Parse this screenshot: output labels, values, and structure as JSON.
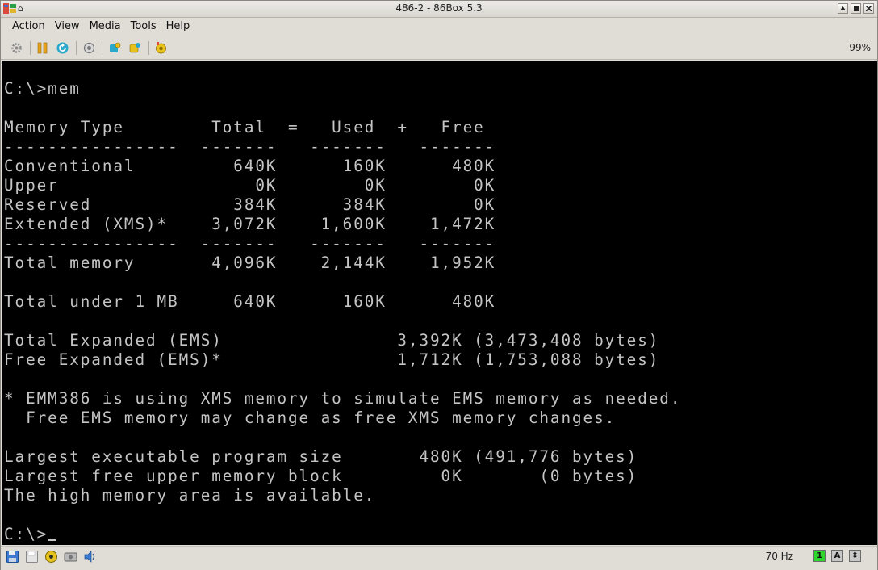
{
  "window": {
    "title": "486-2 - 86Box 5.3"
  },
  "menu": {
    "items": [
      "Action",
      "View",
      "Media",
      "Tools",
      "Help"
    ]
  },
  "toolbar": {
    "icons": [
      "settings-icon",
      "pause-icon",
      "reset-icon",
      "ctrl-alt-del-icon",
      "hard-reset-icon",
      "screenshot-icon",
      "sound-icon"
    ],
    "zoom": "99%"
  },
  "screen": {
    "lines": [
      "C:\\>mem",
      "",
      "Memory Type        Total  =   Used  +   Free",
      "----------------  -------   -------   -------",
      "Conventional         640K      160K      480K",
      "Upper                  0K        0K        0K",
      "Reserved             384K      384K        0K",
      "Extended (XMS)*    3,072K    1,600K    1,472K",
      "----------------  -------   -------   -------",
      "Total memory       4,096K    2,144K    1,952K",
      "",
      "Total under 1 MB     640K      160K      480K",
      "",
      "Total Expanded (EMS)                3,392K (3,473,408 bytes)",
      "Free Expanded (EMS)*                1,712K (1,753,088 bytes)",
      "",
      "* EMM386 is using XMS memory to simulate EMS memory as needed.",
      "  Free EMS memory may change as free XMS memory changes.",
      "",
      "Largest executable program size       480K (491,776 bytes)",
      "Largest free upper memory block         0K       (0 bytes)",
      "The high memory area is available.",
      "",
      "C:\\>"
    ]
  },
  "status": {
    "refresh_rate": "70 Hz",
    "led_labels": [
      "1",
      "A",
      "⇕"
    ],
    "led_colors": [
      "#2dd52d",
      "#c8c8c8",
      "#c8c8c8"
    ]
  },
  "colors": {
    "screen_bg": "#000000",
    "screen_text": "#c4c4c4"
  }
}
